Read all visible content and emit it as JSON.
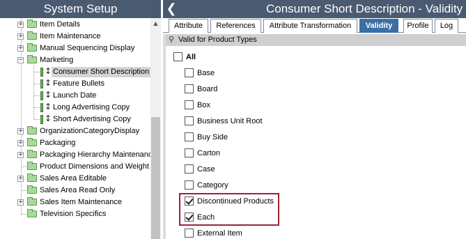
{
  "left": {
    "title": "System Setup",
    "tree": [
      {
        "label": "Item Details",
        "expander": "+",
        "icon": "folder-icon"
      },
      {
        "label": "Item Maintenance",
        "expander": "+",
        "icon": "folder-icon"
      },
      {
        "label": "Manual Sequencing Display",
        "expander": "+",
        "icon": "folder-icon"
      },
      {
        "label": "Marketing",
        "expander": "−",
        "icon": "folder-icon"
      },
      {
        "label": "Consumer Short Description",
        "icon": "attribute-icon",
        "selected": true
      },
      {
        "label": "Feature Bullets",
        "icon": "attribute-icon"
      },
      {
        "label": "Launch Date",
        "icon": "attribute-icon"
      },
      {
        "label": "Long Advertising Copy",
        "icon": "attribute-icon"
      },
      {
        "label": "Short Advertising Copy",
        "icon": "attribute-icon"
      },
      {
        "label": "OrganizationCategoryDisplay",
        "expander": "+",
        "icon": "folder-icon"
      },
      {
        "label": "Packaging",
        "expander": "+",
        "icon": "folder-icon"
      },
      {
        "label": "Packaging Hierarchy Maintenanc",
        "expander": "+",
        "icon": "folder-icon"
      },
      {
        "label": "Product Dimensions and Weight",
        "icon": "folder-icon"
      },
      {
        "label": "Sales Area Editable",
        "expander": "+",
        "icon": "folder-icon"
      },
      {
        "label": "Sales Area Read Only",
        "icon": "folder-icon"
      },
      {
        "label": "Sales Item Maintenance",
        "expander": "+",
        "icon": "folder-icon"
      },
      {
        "label": "Television Specifics",
        "icon": "folder-icon"
      }
    ],
    "scrollbar": {
      "up_icon": "▲"
    }
  },
  "right": {
    "back_icon": "❮",
    "title": "Consumer Short Description - Validity",
    "tabs": [
      {
        "label": "Attribute"
      },
      {
        "label": "References"
      },
      {
        "label": "Attribute Transformation"
      },
      {
        "label": "Validity",
        "active": true
      },
      {
        "label": "Profile"
      },
      {
        "label": "Log"
      }
    ],
    "section": {
      "icon": "pin-icon",
      "icon_glyph": "⚲",
      "label": "Valid for Product Types"
    },
    "all_label": "All",
    "types": [
      {
        "label": "Base",
        "checked": false
      },
      {
        "label": "Board",
        "checked": false
      },
      {
        "label": "Box",
        "checked": false
      },
      {
        "label": "Business Unit Root",
        "checked": false
      },
      {
        "label": "Buy Side",
        "checked": false
      },
      {
        "label": "Carton",
        "checked": false
      },
      {
        "label": "Case",
        "checked": false
      },
      {
        "label": "Category",
        "checked": false
      },
      {
        "label": "Discontinued Products",
        "checked": true
      },
      {
        "label": "Each",
        "checked": true
      },
      {
        "label": "External Item",
        "checked": false
      }
    ],
    "highlight_color": "#9b2335"
  },
  "colors": {
    "header_bg": "#4a5a70",
    "active_tab": "#3a6ea5",
    "folder": "#a8d99a"
  }
}
